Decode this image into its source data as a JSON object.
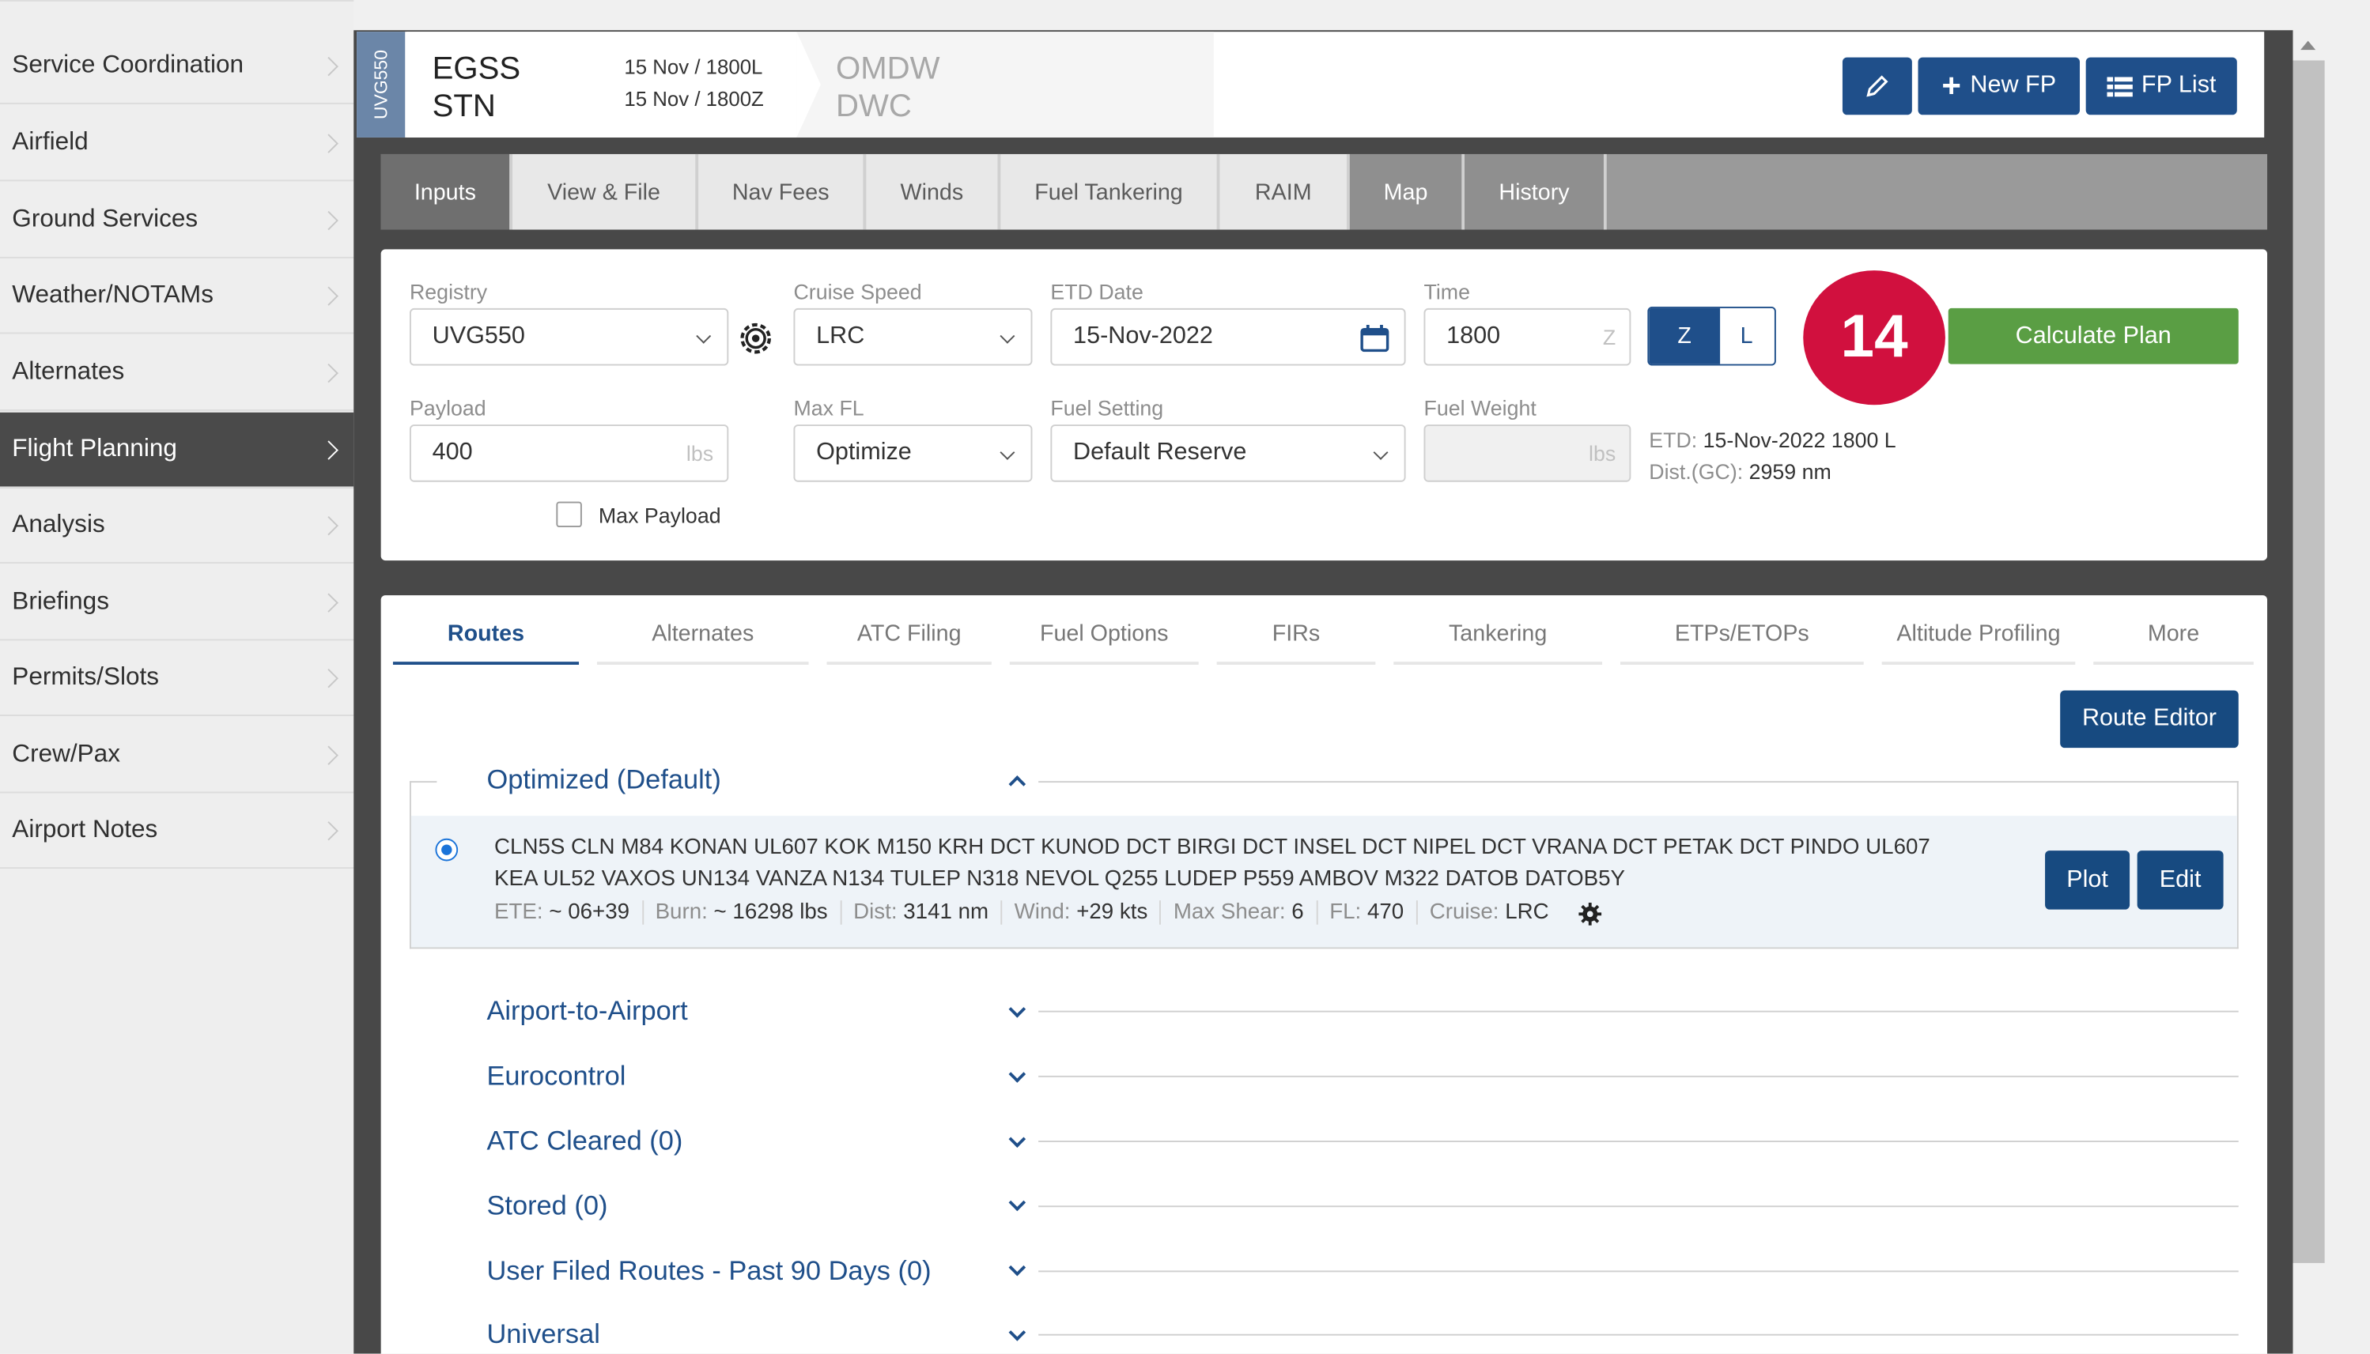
{
  "sidebar": {
    "items": [
      {
        "label": "Service Coordination"
      },
      {
        "label": "Airfield"
      },
      {
        "label": "Ground Services"
      },
      {
        "label": "Weather/NOTAMs"
      },
      {
        "label": "Alternates"
      },
      {
        "label": "Flight Planning",
        "active": true
      },
      {
        "label": "Analysis"
      },
      {
        "label": "Briefings"
      },
      {
        "label": "Permits/Slots"
      },
      {
        "label": "Crew/Pax"
      },
      {
        "label": "Airport Notes"
      }
    ]
  },
  "header": {
    "registry": "UVG550",
    "origin_icao": "EGSS",
    "origin_iata": "STN",
    "date_local": "15 Nov / 1800L",
    "date_zulu": "15 Nov / 1800Z",
    "dest_icao": "OMDW",
    "dest_iata": "DWC",
    "edit_icon": "pencil-icon",
    "new_fp_label": "New FP",
    "fp_list_label": "FP List"
  },
  "tabs": [
    {
      "label": "Inputs"
    },
    {
      "label": "View & File"
    },
    {
      "label": "Nav Fees"
    },
    {
      "label": "Winds"
    },
    {
      "label": "Fuel Tankering"
    },
    {
      "label": "RAIM"
    },
    {
      "label": "Map"
    },
    {
      "label": "History"
    }
  ],
  "inputs": {
    "registry_label": "Registry",
    "registry_value": "UVG550",
    "cruise_label": "Cruise Speed",
    "cruise_value": "LRC",
    "etd_label": "ETD Date",
    "etd_value": "15-Nov-2022",
    "time_label": "Time",
    "time_value": "1800",
    "time_unit": "Z",
    "z_label": "Z",
    "l_label": "L",
    "payload_label": "Payload",
    "payload_value": "400",
    "payload_unit": "lbs",
    "maxfl_label": "Max FL",
    "maxfl_value": "Optimize",
    "fuel_setting_label": "Fuel Setting",
    "fuel_setting_value": "Default Reserve",
    "fuel_weight_label": "Fuel Weight",
    "fuel_weight_unit": "lbs",
    "max_payload_label": "Max Payload",
    "etd_info_key": "ETD:",
    "etd_info_value": "15-Nov-2022 1800 L",
    "dist_info_key": "Dist.(GC):",
    "dist_info_value": "2959 nm",
    "calculate_label": "Calculate Plan"
  },
  "badge": {
    "number": "14",
    "color": "#d1103e"
  },
  "route_tabs": [
    {
      "label": "Routes"
    },
    {
      "label": "Alternates"
    },
    {
      "label": "ATC Filing"
    },
    {
      "label": "Fuel Options"
    },
    {
      "label": "FIRs"
    },
    {
      "label": "Tankering"
    },
    {
      "label": "ETPs/ETOPs"
    },
    {
      "label": "Altitude Profiling"
    },
    {
      "label": "More"
    }
  ],
  "routes": {
    "route_editor_label": "Route Editor",
    "optimized_title": "Optimized (Default)",
    "route_line1": "CLN5S CLN M84 KONAN UL607 KOK M150 KRH DCT KUNOD DCT BIRGI DCT INSEL DCT NIPEL DCT VRANA DCT PETAK DCT PINDO UL607",
    "route_line2": "KEA UL52 VAXOS UN134 VANZA N134 TULEP N318 NEVOL Q255 LUDEP P559 AMBOV M322 DATOB DATOB5Y",
    "stats": [
      {
        "key": "ETE:",
        "value": "~ 06+39"
      },
      {
        "key": "Burn:",
        "value": "~ 16298 lbs"
      },
      {
        "key": "Dist:",
        "value": "3141 nm"
      },
      {
        "key": "Wind:",
        "value": "+29 kts"
      },
      {
        "key": "Max Shear:",
        "value": "6"
      },
      {
        "key": "FL:",
        "value": "470"
      },
      {
        "key": "Cruise:",
        "value": "LRC"
      }
    ],
    "plot_label": "Plot",
    "edit_label": "Edit",
    "sections": [
      {
        "title": "Airport-to-Airport"
      },
      {
        "title": "Eurocontrol"
      },
      {
        "title": "ATC Cleared (0)"
      },
      {
        "title": "Stored (0)"
      },
      {
        "title": "User Filed Routes - Past 90 Days (0)"
      },
      {
        "title": "Universal"
      }
    ]
  },
  "colors": {
    "primary": "#1f4f8a",
    "calculate": "#5a9e44",
    "sidebar_active": "#4a4a4a"
  }
}
